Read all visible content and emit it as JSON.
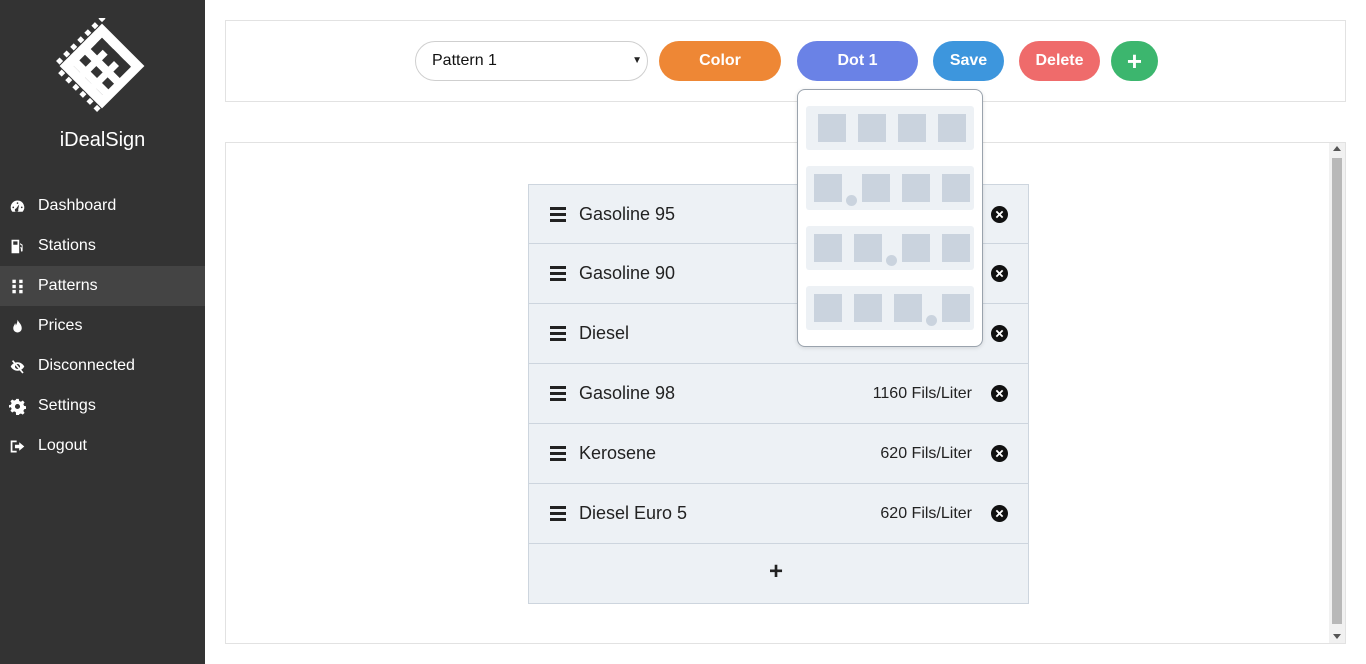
{
  "brand": {
    "name": "iDealSign"
  },
  "sidebar": {
    "items": [
      {
        "label": "Dashboard",
        "icon": "tachometer-icon"
      },
      {
        "label": "Stations",
        "icon": "gas-pump-icon"
      },
      {
        "label": "Patterns",
        "icon": "grip-icon",
        "active": true
      },
      {
        "label": "Prices",
        "icon": "fire-icon"
      },
      {
        "label": "Disconnected",
        "icon": "eye-slash-icon"
      },
      {
        "label": "Settings",
        "icon": "gear-icon"
      },
      {
        "label": "Logout",
        "icon": "sign-out-icon"
      }
    ]
  },
  "toolbar": {
    "pattern_select": "Pattern 1",
    "color_label": "Color",
    "dot_label": "Dot 1",
    "save_label": "Save",
    "delete_label": "Delete",
    "add_label": "+"
  },
  "colors": {
    "sidebar_bg": "#333333",
    "color_button": "#ee8735",
    "dot_button": "#6a82e6",
    "save_button": "#3d96dd",
    "delete_button": "#ef6b6b",
    "add_button": "#3cb66e"
  },
  "fuels": [
    {
      "name": "Gasoline 95",
      "price": ""
    },
    {
      "name": "Gasoline 90",
      "price": ""
    },
    {
      "name": "Diesel",
      "price": ""
    },
    {
      "name": "Gasoline 98",
      "price": "1160 Fils/Liter"
    },
    {
      "name": "Kerosene",
      "price": "620 Fils/Liter"
    },
    {
      "name": "Diesel Euro 5",
      "price": "620 Fils/Liter"
    }
  ],
  "add_row_label": "+",
  "dot_options": [
    {
      "dot_after_digit": 0
    },
    {
      "dot_after_digit": 1
    },
    {
      "dot_after_digit": 2
    },
    {
      "dot_after_digit": 3
    }
  ]
}
